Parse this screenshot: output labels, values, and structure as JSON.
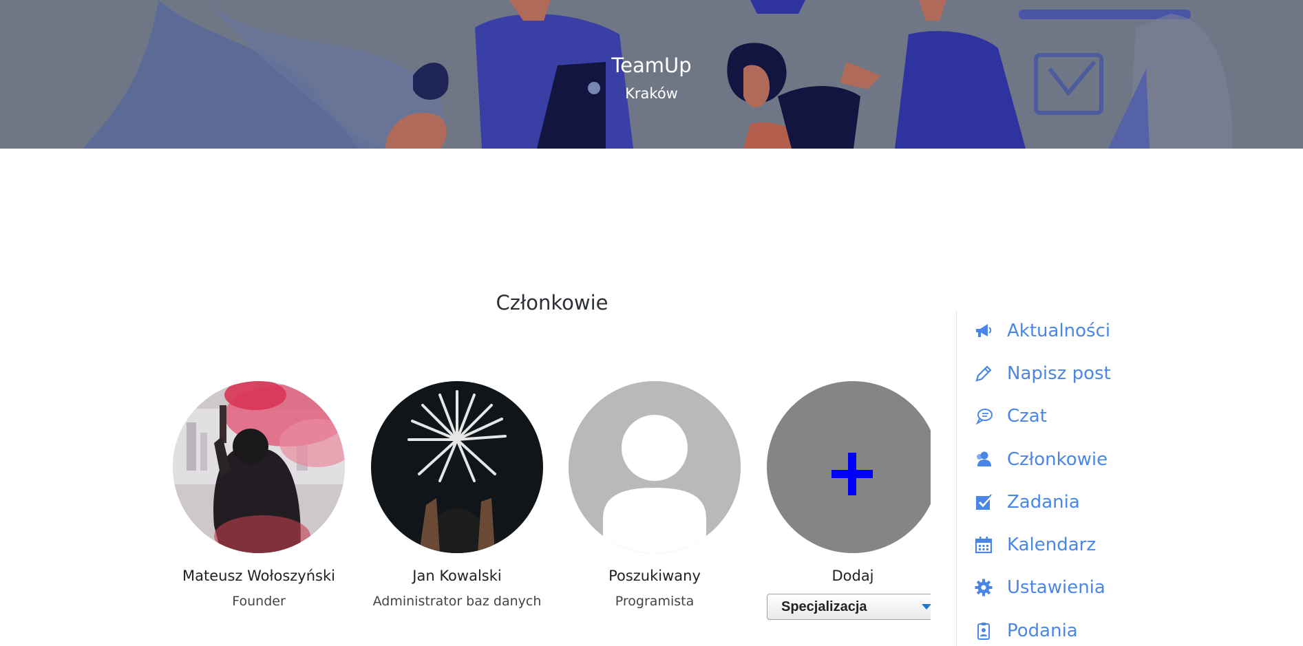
{
  "banner": {
    "title": "TeamUp",
    "subtitle": "Kraków"
  },
  "section": {
    "title": "Członkowie"
  },
  "members": [
    {
      "name": "Mateusz Wołoszyński",
      "role": "Founder"
    },
    {
      "name": "Jan Kowalski",
      "role": "Administrator baz danych"
    },
    {
      "name": "Poszukiwany",
      "role": "Programista"
    }
  ],
  "add_member": {
    "label": "Dodaj",
    "select_value": "Specjalizacja"
  },
  "sidebar": {
    "items": [
      {
        "label": "Aktualności",
        "icon": "megaphone-icon"
      },
      {
        "label": "Napisz post",
        "icon": "pencil-icon"
      },
      {
        "label": "Czat",
        "icon": "chat-icon"
      },
      {
        "label": "Członkowie",
        "icon": "users-icon"
      },
      {
        "label": "Zadania",
        "icon": "checkbox-icon"
      },
      {
        "label": "Kalendarz",
        "icon": "calendar-icon"
      },
      {
        "label": "Ustawienia",
        "icon": "gear-icon"
      },
      {
        "label": "Podania",
        "icon": "id-badge-icon"
      }
    ]
  },
  "colors": {
    "accent": "#4a86e8",
    "banner_overlay": "#6f7787",
    "add_plus": "#0000ff",
    "add_bg": "#858585"
  }
}
